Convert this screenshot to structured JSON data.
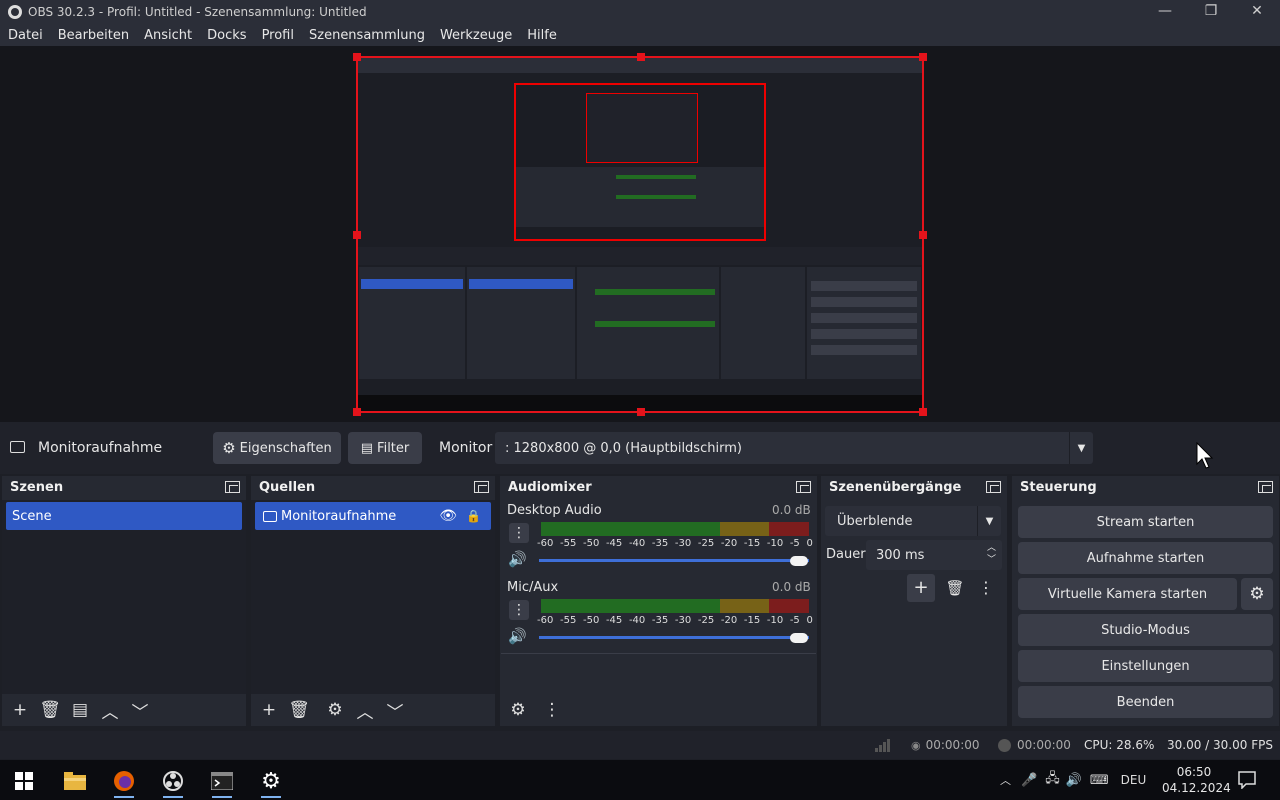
{
  "window": {
    "title": "OBS 30.2.3 - Profil: Untitled - Szenensammlung: Untitled",
    "controls": [
      "—",
      "❐",
      "✕"
    ]
  },
  "menu": [
    "Datei",
    "Bearbeiten",
    "Ansicht",
    "Docks",
    "Profil",
    "Szenensammlung",
    "Werkzeuge",
    "Hilfe"
  ],
  "sourcebar": {
    "source_name": "Monitoraufnahme",
    "properties_label": "Eigenschaften",
    "filter_label": "Filter",
    "monitor_label": "Monitor",
    "monitor_value": ": 1280x800 @ 0,0 (Hauptbildschirm)"
  },
  "scenes": {
    "title": "Szenen",
    "items": [
      "Scene"
    ]
  },
  "sources": {
    "title": "Quellen",
    "items": [
      "Monitoraufnahme"
    ]
  },
  "audiomixer": {
    "title": "Audiomixer",
    "scale": [
      "-60",
      "-55",
      "-50",
      "-45",
      "-40",
      "-35",
      "-30",
      "-25",
      "-20",
      "-15",
      "-10",
      "-5",
      "0"
    ],
    "channels": [
      {
        "name": "Desktop Audio",
        "db": "0.0 dB",
        "volume": 1.0
      },
      {
        "name": "Mic/Aux",
        "db": "0.0 dB",
        "volume": 1.0
      }
    ]
  },
  "transitions": {
    "title": "Szenenübergänge",
    "selected": "Überblende",
    "duration_label": "Dauer",
    "duration_value": "300 ms"
  },
  "controls": {
    "title": "Steuerung",
    "stream": "Stream starten",
    "record": "Aufnahme starten",
    "virtual_cam": "Virtuelle Kamera starten",
    "studio": "Studio-Modus",
    "settings": "Einstellungen",
    "exit": "Beenden"
  },
  "status": {
    "stream_time": "00:00:00",
    "record_time": "00:00:00",
    "cpu": "CPU: 28.6%",
    "fps": "30.00 / 30.00 FPS"
  },
  "taskbar": {
    "language": "DEU",
    "time": "06:50",
    "date": "04.12.2024"
  },
  "colors": {
    "selection": "#e4131b",
    "accent": "#2f59c4",
    "meter_green": "#226c22",
    "meter_yellow": "#776217",
    "meter_red": "#7c1d1d"
  }
}
